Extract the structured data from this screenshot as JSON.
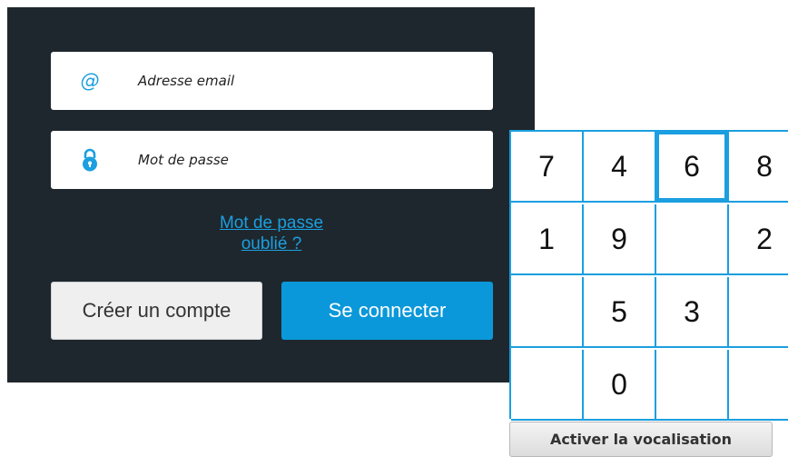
{
  "login": {
    "email": {
      "icon": "at-sign-icon",
      "value": "Adresse email"
    },
    "password": {
      "icon": "lock-icon",
      "value": "Mot de passe"
    },
    "forgot_line1": "Mot de passe",
    "forgot_line2": "oublié ?",
    "create_account_label": "Créer un compte",
    "connect_label": "Se connecter"
  },
  "keypad": {
    "keys": [
      "7",
      "4",
      "6",
      "8",
      "1",
      "9",
      "",
      "2",
      "",
      "5",
      "3",
      "",
      "",
      "0",
      "",
      ""
    ],
    "focused_index": 2,
    "vocalisation_label": "Activer la vocalisation"
  },
  "colors": {
    "panel_bg": "#1e272d",
    "accent": "#1b9fe0",
    "primary_button": "#0a98da"
  }
}
